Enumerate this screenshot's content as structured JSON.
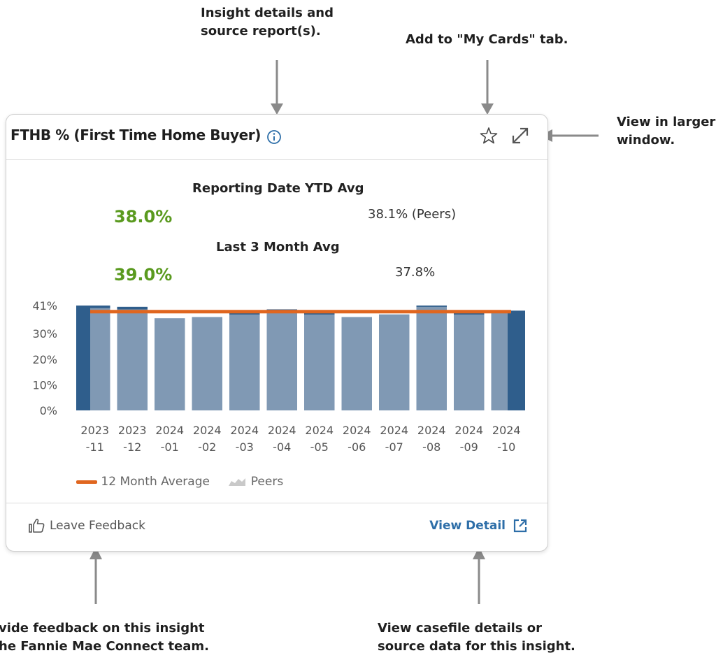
{
  "callouts": {
    "info_line1": "Insight details and",
    "info_line2": "source report(s).",
    "mycards": "Add to \"My Cards\" tab.",
    "larger_line1": "View in larger",
    "larger_line2": "window.",
    "feedback_line1": "vide feedback on this insight",
    "feedback_line2": "he Fannie Mae Connect team.",
    "detail_line1": "View casefile details or",
    "detail_line2": "source data for this insight."
  },
  "card": {
    "title": "FTHB % (First Time Home Buyer)",
    "ytd_heading": "Reporting Date YTD Avg",
    "ytd_value": "38.0%",
    "ytd_peers": "38.1% (Peers)",
    "last3_heading": "Last 3 Month Avg",
    "last3_value": "39.0%",
    "last3_peers": "37.8%",
    "legend_avg": "12 Month Average",
    "legend_peers": "Peers",
    "feedback_label": "Leave Feedback",
    "detail_label": "View Detail"
  },
  "icons": {
    "info": "info-icon",
    "star": "star-icon",
    "expand": "expand-icon",
    "thumbs_up": "thumbs-up-icon",
    "external_link": "external-link-icon"
  },
  "colors": {
    "value_green": "#5a9a1f",
    "bar_dark": "#2f5e8c",
    "peers_bar": "#a9b6c6",
    "avg_line": "#e0661f",
    "link_blue": "#2d6ea8"
  },
  "chart_data": {
    "type": "bar",
    "categories": [
      "2023\n-11",
      "2023\n-12",
      "2024\n-01",
      "2024\n-02",
      "2024\n-03",
      "2024\n-04",
      "2024\n-05",
      "2024\n-06",
      "2024\n-07",
      "2024\n-08",
      "2024\n-09",
      "2024\n-10"
    ],
    "tick_labels_top": [
      "2023",
      "2023",
      "2024",
      "2024",
      "2024",
      "2024",
      "2024",
      "2024",
      "2024",
      "2024",
      "2024",
      "2024"
    ],
    "tick_labels_bottom": [
      "-11",
      "-12",
      "-01",
      "-02",
      "-03",
      "-04",
      "-05",
      "-06",
      "-07",
      "-08",
      "-09",
      "-10"
    ],
    "series": [
      {
        "name": "",
        "values": [
          41,
          40.5,
          36,
          36.5,
          38,
          39.5,
          38,
          36.5,
          37.5,
          41,
          38,
          39
        ]
      },
      {
        "name": "Peers",
        "values": [
          40,
          39.5,
          36,
          36.5,
          37.5,
          38.5,
          37.5,
          36.5,
          37.5,
          40.5,
          37.5,
          38
        ]
      },
      {
        "name": "12 Month Average",
        "values": [
          38.6,
          38.6,
          38.6,
          38.6,
          38.6,
          38.6,
          38.6,
          38.6,
          38.6,
          38.6,
          38.6,
          38.6
        ]
      }
    ],
    "yticks": [
      "41%",
      "30%",
      "20%",
      "10%",
      "0%"
    ],
    "ytick_values": [
      41,
      30,
      20,
      10,
      0
    ],
    "ylim": [
      0,
      41
    ],
    "legend": "bottom-left",
    "grid": false
  }
}
